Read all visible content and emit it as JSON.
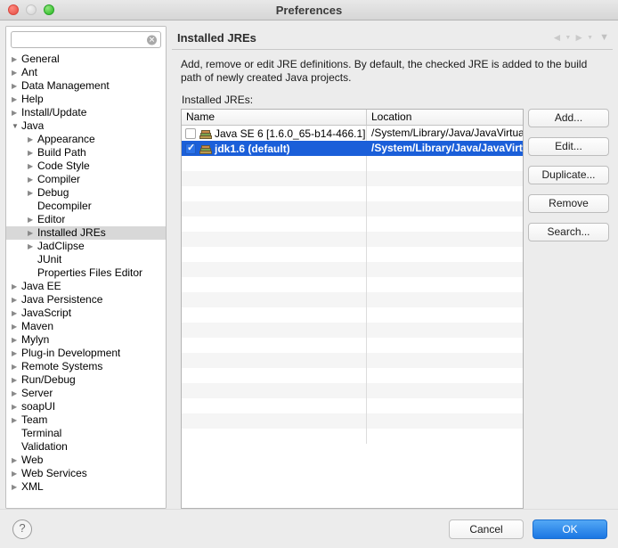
{
  "window": {
    "title": "Preferences",
    "traffic_lights": [
      "close-button",
      "minimize-button",
      "zoom-button"
    ]
  },
  "sidebar": {
    "search": {
      "value": "",
      "placeholder": "",
      "clear_glyph": "✕"
    },
    "selected": "Installed JREs",
    "items": [
      {
        "label": "General",
        "depth": 1,
        "arrow": "right"
      },
      {
        "label": "Ant",
        "depth": 1,
        "arrow": "right"
      },
      {
        "label": "Data Management",
        "depth": 1,
        "arrow": "right"
      },
      {
        "label": "Help",
        "depth": 1,
        "arrow": "right"
      },
      {
        "label": "Install/Update",
        "depth": 1,
        "arrow": "right"
      },
      {
        "label": "Java",
        "depth": 1,
        "arrow": "down"
      },
      {
        "label": "Appearance",
        "depth": 2,
        "arrow": "right"
      },
      {
        "label": "Build Path",
        "depth": 2,
        "arrow": "right"
      },
      {
        "label": "Code Style",
        "depth": 2,
        "arrow": "right"
      },
      {
        "label": "Compiler",
        "depth": 2,
        "arrow": "right"
      },
      {
        "label": "Debug",
        "depth": 2,
        "arrow": "right"
      },
      {
        "label": "Decompiler",
        "depth": 2,
        "arrow": "none"
      },
      {
        "label": "Editor",
        "depth": 2,
        "arrow": "right"
      },
      {
        "label": "Installed JREs",
        "depth": 2,
        "arrow": "right",
        "selected": true
      },
      {
        "label": "JadClipse",
        "depth": 2,
        "arrow": "right"
      },
      {
        "label": "JUnit",
        "depth": 2,
        "arrow": "none"
      },
      {
        "label": "Properties Files Editor",
        "depth": 2,
        "arrow": "none"
      },
      {
        "label": "Java EE",
        "depth": 1,
        "arrow": "right"
      },
      {
        "label": "Java Persistence",
        "depth": 1,
        "arrow": "right"
      },
      {
        "label": "JavaScript",
        "depth": 1,
        "arrow": "right"
      },
      {
        "label": "Maven",
        "depth": 1,
        "arrow": "right"
      },
      {
        "label": "Mylyn",
        "depth": 1,
        "arrow": "right"
      },
      {
        "label": "Plug-in Development",
        "depth": 1,
        "arrow": "right"
      },
      {
        "label": "Remote Systems",
        "depth": 1,
        "arrow": "right"
      },
      {
        "label": "Run/Debug",
        "depth": 1,
        "arrow": "right"
      },
      {
        "label": "Server",
        "depth": 1,
        "arrow": "right"
      },
      {
        "label": "soapUI",
        "depth": 1,
        "arrow": "right"
      },
      {
        "label": "Team",
        "depth": 1,
        "arrow": "right"
      },
      {
        "label": "Terminal",
        "depth": 1,
        "arrow": "none"
      },
      {
        "label": "Validation",
        "depth": 1,
        "arrow": "none"
      },
      {
        "label": "Web",
        "depth": 1,
        "arrow": "right"
      },
      {
        "label": "Web Services",
        "depth": 1,
        "arrow": "right"
      },
      {
        "label": "XML",
        "depth": 1,
        "arrow": "right"
      }
    ]
  },
  "main": {
    "title": "Installed JREs",
    "toolbar": {
      "back_glyph": "◄",
      "back_menu_glyph": "▼",
      "forward_glyph": "►",
      "forward_menu_glyph": "▼",
      "menu_glyph": "▼"
    },
    "description": "Add, remove or edit JRE definitions. By default, the checked JRE is added to the build path of newly created Java projects.",
    "list_label": "Installed JREs:",
    "table": {
      "columns": [
        "Name",
        "Location"
      ],
      "rows": [
        {
          "checked": false,
          "name": "Java SE 6 [1.6.0_65-b14-466.1]",
          "location": "/System/Library/Java/JavaVirtua",
          "selected": false
        },
        {
          "checked": true,
          "name": "jdk1.6 (default)",
          "location": "/System/Library/Java/JavaVirtua",
          "selected": true
        }
      ],
      "empty_rows": 19
    },
    "buttons": [
      {
        "label": "Add...",
        "name": "add-button"
      },
      {
        "label": "Edit...",
        "name": "edit-button"
      },
      {
        "label": "Duplicate...",
        "name": "duplicate-button"
      },
      {
        "label": "Remove",
        "name": "remove-button"
      },
      {
        "label": "Search...",
        "name": "search-jre-button"
      }
    ]
  },
  "footer": {
    "help_glyph": "?",
    "cancel_label": "Cancel",
    "ok_label": "OK"
  },
  "colors": {
    "selection_blue": "#1b5fd9",
    "ok_button_blue": "#1a76e3",
    "tree_selection_gray": "#d8d8d8",
    "window_background": "#ececec"
  }
}
